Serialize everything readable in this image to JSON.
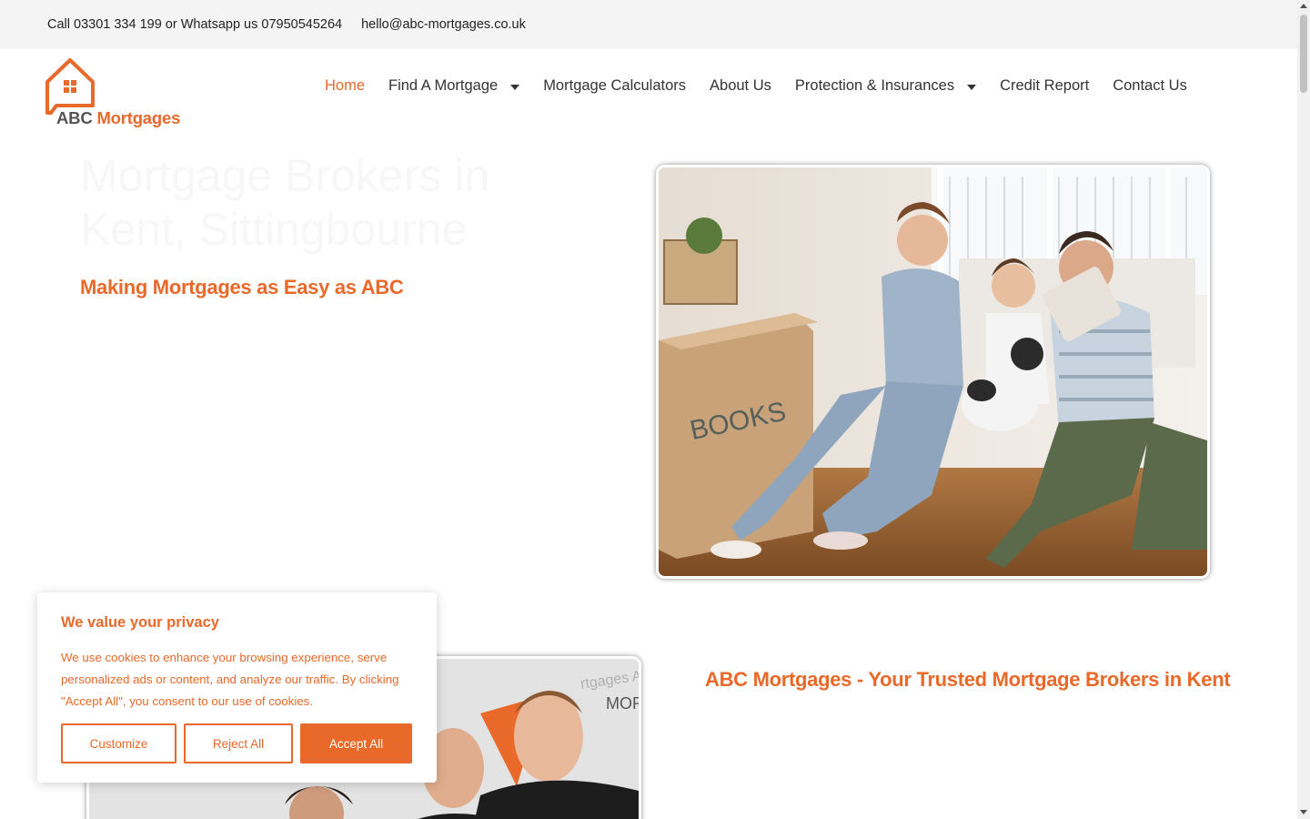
{
  "topbar": {
    "phone_text": "Call 03301 334 199 or Whatsapp us 07950545264",
    "email": "hello@abc-mortgages.co.uk"
  },
  "logo": {
    "abc": "ABC",
    "mortgages": "Mortgages"
  },
  "nav": {
    "items": [
      {
        "label": "Home",
        "active": true,
        "has_caret": false
      },
      {
        "label": "Find A Mortgage",
        "active": false,
        "has_caret": true
      },
      {
        "label": "Mortgage Calculators",
        "active": false,
        "has_caret": false
      },
      {
        "label": "About Us",
        "active": false,
        "has_caret": false
      },
      {
        "label": "Protection & Insurances",
        "active": false,
        "has_caret": true
      },
      {
        "label": "Credit Report",
        "active": false,
        "has_caret": false
      },
      {
        "label": "Contact Us",
        "active": false,
        "has_caret": false
      }
    ]
  },
  "hero": {
    "title": "Mortgage Brokers in Kent, Sittingbourne",
    "subtitle": "Making Mortgages as Easy as ABC",
    "image_box_label": "BOOKS"
  },
  "section2": {
    "title": "ABC Mortgages - Your Trusted Mortgage Brokers in Kent",
    "team_image_text_1": "rtgages As",
    "team_image_text_2": "MORTGA"
  },
  "cookie": {
    "title": "We value your privacy",
    "text": "We use cookies to enhance your browsing experience, serve personalized ads or content, and analyze our traffic. By clicking \"Accept All\", you consent to our use of cookies.",
    "customize": "Customize",
    "reject": "Reject All",
    "accept": "Accept All"
  },
  "colors": {
    "accent": "#e8692a",
    "topbar_bg": "#f4f4f4"
  }
}
